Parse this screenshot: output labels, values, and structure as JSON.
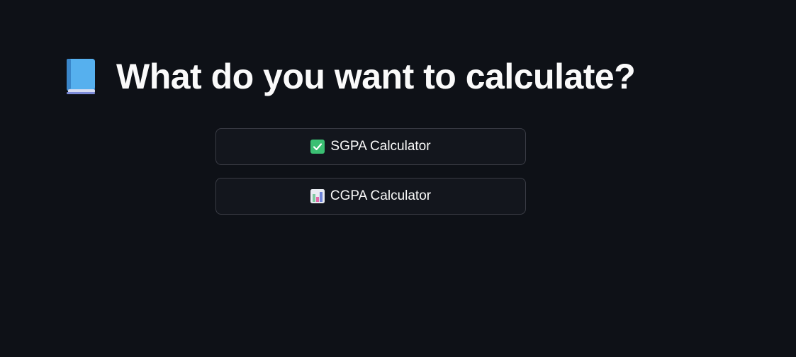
{
  "page": {
    "heading": "What do you want to calculate?",
    "heading_icon": "blue-book-icon"
  },
  "buttons": [
    {
      "label": "SGPA Calculator",
      "icon": "check-mark-button-icon"
    },
    {
      "label": "CGPA Calculator",
      "icon": "bar-chart-icon"
    }
  ],
  "colors": {
    "background": "#0e1117",
    "text": "#fafafa",
    "button_border": "#3a3c45",
    "check_green": "#3bbf73",
    "book_blue": "#4aa3e8"
  }
}
